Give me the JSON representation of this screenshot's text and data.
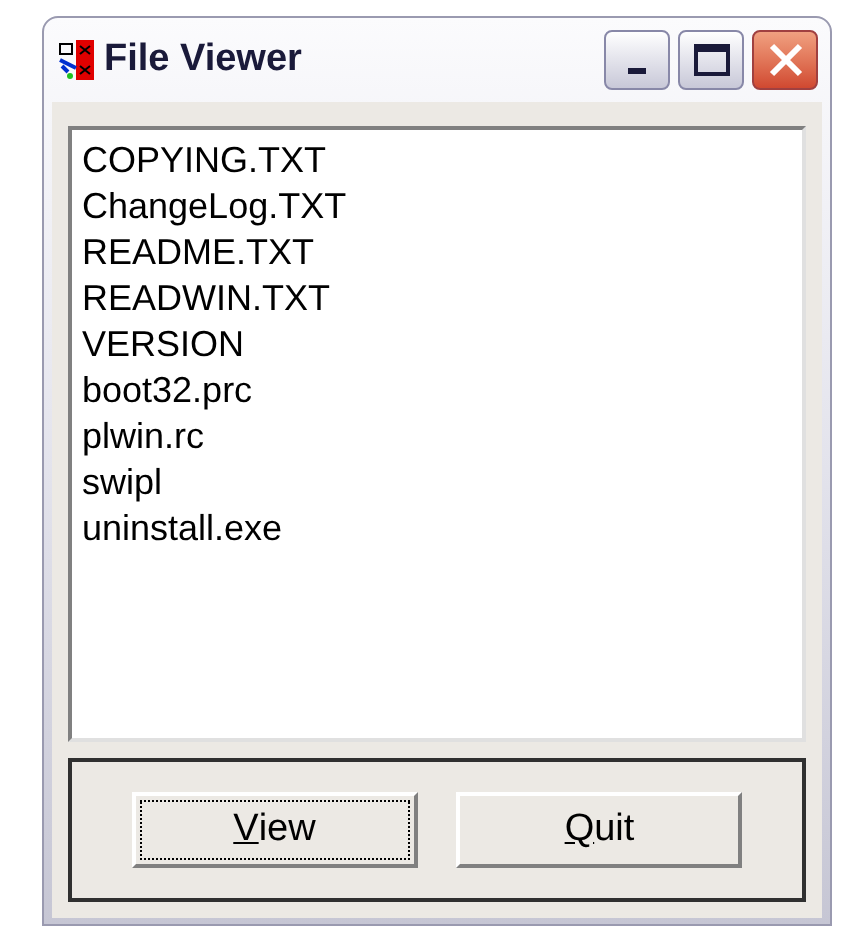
{
  "window": {
    "title": "File Viewer"
  },
  "files": [
    "COPYING.TXT",
    "ChangeLog.TXT",
    "README.TXT",
    "READWIN.TXT",
    "VERSION",
    "boot32.prc",
    "plwin.rc",
    "swipl",
    "uninstall.exe"
  ],
  "buttons": [
    {
      "mnemonic": "V",
      "rest": "iew",
      "focused": true
    },
    {
      "mnemonic": "Q",
      "rest": "uit",
      "focused": false
    }
  ]
}
